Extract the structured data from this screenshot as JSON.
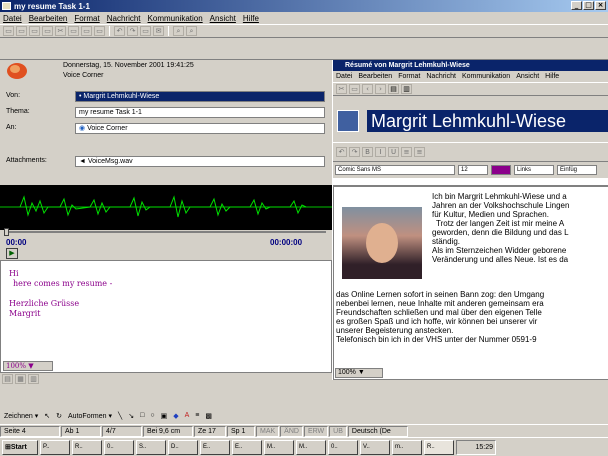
{
  "app": {
    "title": "my resume Task 1-1"
  },
  "menu": [
    "Datei",
    "Bearbeiten",
    "Format",
    "Nachricht",
    "Kommunikation",
    "Ansicht",
    "Hilfe"
  ],
  "header": {
    "date": "Donnerstag, 15. November 2001 19:41:25",
    "sender_name": "Voice Corner",
    "von_label": "Von:",
    "von_value": "Margrit Lehmkuhl-Wiese",
    "thema_label": "Thema:",
    "thema_value": "my resume Task 1-1",
    "an_label": "An:",
    "an_value": "Voice Corner",
    "att_label": "Attachments:",
    "att_value": "VoiceMsg.wav"
  },
  "player": {
    "time_start": "00:00",
    "time_end": "00:00:00"
  },
  "message": {
    "lines": [
      "Hi",
      "here comes my resume -",
      "",
      "Herzliche Grüsse",
      "Margrit"
    ]
  },
  "zoom": "100%",
  "draw": {
    "label": "Zeichnen",
    "autoformen": "AutoFormen"
  },
  "resume": {
    "title": "Résumé von Margrit Lehmkuhl-Wiese",
    "menu": [
      "Datei",
      "Bearbeiten",
      "Format",
      "Nachricht",
      "Kommunikation",
      "Ansicht",
      "Hilfe"
    ],
    "heading": "Margrit Lehmkuhl-Wiese",
    "font": "Comic Sans MS",
    "size": "12",
    "align": "Links",
    "extra": "Einfüg",
    "text": [
      "Ich bin Margrit Lehmkuhl-Wiese und a",
      "Jahren an der Volkshochschule Lingen",
      "für Kultur, Medien und Sprachen.",
      "Trotz der langen Zeit ist mir meine A",
      "geworden, denn die Bildung und das L",
      "ständig.",
      "Als im Sternzeichen Widder geborene",
      "Veränderung und alles Neue. Ist es da",
      "das Online Lernen sofort in seinen Bann zog: den Umgang",
      "nebenbei lernen, neue Inhalte mit anderen gemeinsam era",
      "Freundschaften schließen und mal über den eigenen Telle",
      "es großen Spaß und ich hoffe, wir können bei unserer vir",
      "unserer Begeisterung anstecken.",
      "Telefonisch bin ich in der VHS unter der Nummer 0591-9"
    ],
    "zoom": "100%"
  },
  "status": {
    "seite": "Seite 4",
    "ab": "Ab 1",
    "pages": "4/7",
    "bei": "Bei 9,6 cm",
    "ze": "Ze 17",
    "sp": "Sp 1",
    "mak": "MAK",
    "aend": "ÄND",
    "erw": "ERW",
    "ub": "ÜB",
    "lang": "Deutsch (De"
  },
  "taskbar": {
    "start": "Start",
    "tasks": [
      "P..",
      "R..",
      "0..",
      "S..",
      "D..",
      "E..",
      "E..",
      "M..",
      "M..",
      "0..",
      "V..",
      "m..",
      "R.."
    ],
    "clock": "15:29"
  },
  "colors": {
    "title_blue": "#0a246a",
    "accent_purple": "#8b008b",
    "wave_green": "#00c000"
  }
}
